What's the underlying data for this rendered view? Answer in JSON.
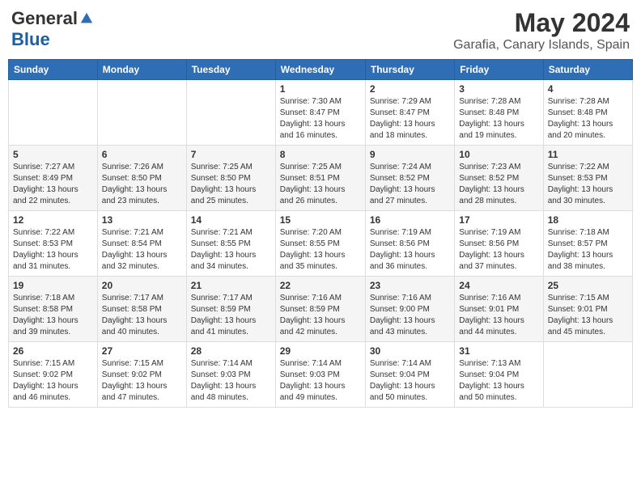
{
  "logo": {
    "general": "General",
    "blue": "Blue"
  },
  "title": {
    "month_year": "May 2024",
    "location": "Garafia, Canary Islands, Spain"
  },
  "days_of_week": [
    "Sunday",
    "Monday",
    "Tuesday",
    "Wednesday",
    "Thursday",
    "Friday",
    "Saturday"
  ],
  "weeks": [
    [
      {
        "day": "",
        "info": ""
      },
      {
        "day": "",
        "info": ""
      },
      {
        "day": "",
        "info": ""
      },
      {
        "day": "1",
        "info": "Sunrise: 7:30 AM\nSunset: 8:47 PM\nDaylight: 13 hours\nand 16 minutes."
      },
      {
        "day": "2",
        "info": "Sunrise: 7:29 AM\nSunset: 8:47 PM\nDaylight: 13 hours\nand 18 minutes."
      },
      {
        "day": "3",
        "info": "Sunrise: 7:28 AM\nSunset: 8:48 PM\nDaylight: 13 hours\nand 19 minutes."
      },
      {
        "day": "4",
        "info": "Sunrise: 7:28 AM\nSunset: 8:48 PM\nDaylight: 13 hours\nand 20 minutes."
      }
    ],
    [
      {
        "day": "5",
        "info": "Sunrise: 7:27 AM\nSunset: 8:49 PM\nDaylight: 13 hours\nand 22 minutes."
      },
      {
        "day": "6",
        "info": "Sunrise: 7:26 AM\nSunset: 8:50 PM\nDaylight: 13 hours\nand 23 minutes."
      },
      {
        "day": "7",
        "info": "Sunrise: 7:25 AM\nSunset: 8:50 PM\nDaylight: 13 hours\nand 25 minutes."
      },
      {
        "day": "8",
        "info": "Sunrise: 7:25 AM\nSunset: 8:51 PM\nDaylight: 13 hours\nand 26 minutes."
      },
      {
        "day": "9",
        "info": "Sunrise: 7:24 AM\nSunset: 8:52 PM\nDaylight: 13 hours\nand 27 minutes."
      },
      {
        "day": "10",
        "info": "Sunrise: 7:23 AM\nSunset: 8:52 PM\nDaylight: 13 hours\nand 28 minutes."
      },
      {
        "day": "11",
        "info": "Sunrise: 7:22 AM\nSunset: 8:53 PM\nDaylight: 13 hours\nand 30 minutes."
      }
    ],
    [
      {
        "day": "12",
        "info": "Sunrise: 7:22 AM\nSunset: 8:53 PM\nDaylight: 13 hours\nand 31 minutes."
      },
      {
        "day": "13",
        "info": "Sunrise: 7:21 AM\nSunset: 8:54 PM\nDaylight: 13 hours\nand 32 minutes."
      },
      {
        "day": "14",
        "info": "Sunrise: 7:21 AM\nSunset: 8:55 PM\nDaylight: 13 hours\nand 34 minutes."
      },
      {
        "day": "15",
        "info": "Sunrise: 7:20 AM\nSunset: 8:55 PM\nDaylight: 13 hours\nand 35 minutes."
      },
      {
        "day": "16",
        "info": "Sunrise: 7:19 AM\nSunset: 8:56 PM\nDaylight: 13 hours\nand 36 minutes."
      },
      {
        "day": "17",
        "info": "Sunrise: 7:19 AM\nSunset: 8:56 PM\nDaylight: 13 hours\nand 37 minutes."
      },
      {
        "day": "18",
        "info": "Sunrise: 7:18 AM\nSunset: 8:57 PM\nDaylight: 13 hours\nand 38 minutes."
      }
    ],
    [
      {
        "day": "19",
        "info": "Sunrise: 7:18 AM\nSunset: 8:58 PM\nDaylight: 13 hours\nand 39 minutes."
      },
      {
        "day": "20",
        "info": "Sunrise: 7:17 AM\nSunset: 8:58 PM\nDaylight: 13 hours\nand 40 minutes."
      },
      {
        "day": "21",
        "info": "Sunrise: 7:17 AM\nSunset: 8:59 PM\nDaylight: 13 hours\nand 41 minutes."
      },
      {
        "day": "22",
        "info": "Sunrise: 7:16 AM\nSunset: 8:59 PM\nDaylight: 13 hours\nand 42 minutes."
      },
      {
        "day": "23",
        "info": "Sunrise: 7:16 AM\nSunset: 9:00 PM\nDaylight: 13 hours\nand 43 minutes."
      },
      {
        "day": "24",
        "info": "Sunrise: 7:16 AM\nSunset: 9:01 PM\nDaylight: 13 hours\nand 44 minutes."
      },
      {
        "day": "25",
        "info": "Sunrise: 7:15 AM\nSunset: 9:01 PM\nDaylight: 13 hours\nand 45 minutes."
      }
    ],
    [
      {
        "day": "26",
        "info": "Sunrise: 7:15 AM\nSunset: 9:02 PM\nDaylight: 13 hours\nand 46 minutes."
      },
      {
        "day": "27",
        "info": "Sunrise: 7:15 AM\nSunset: 9:02 PM\nDaylight: 13 hours\nand 47 minutes."
      },
      {
        "day": "28",
        "info": "Sunrise: 7:14 AM\nSunset: 9:03 PM\nDaylight: 13 hours\nand 48 minutes."
      },
      {
        "day": "29",
        "info": "Sunrise: 7:14 AM\nSunset: 9:03 PM\nDaylight: 13 hours\nand 49 minutes."
      },
      {
        "day": "30",
        "info": "Sunrise: 7:14 AM\nSunset: 9:04 PM\nDaylight: 13 hours\nand 50 minutes."
      },
      {
        "day": "31",
        "info": "Sunrise: 7:13 AM\nSunset: 9:04 PM\nDaylight: 13 hours\nand 50 minutes."
      },
      {
        "day": "",
        "info": ""
      }
    ]
  ]
}
